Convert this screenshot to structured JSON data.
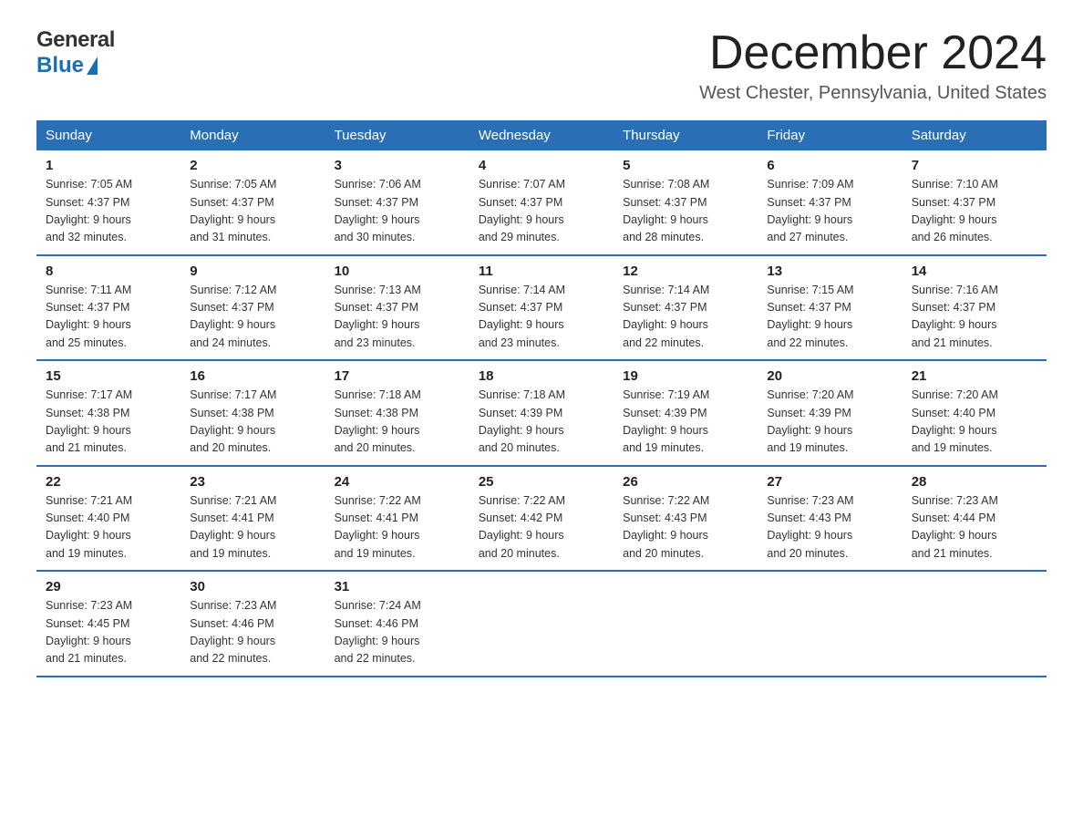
{
  "logo": {
    "general": "General",
    "blue": "Blue"
  },
  "title": "December 2024",
  "subtitle": "West Chester, Pennsylvania, United States",
  "days_of_week": [
    "Sunday",
    "Monday",
    "Tuesday",
    "Wednesday",
    "Thursday",
    "Friday",
    "Saturday"
  ],
  "weeks": [
    [
      {
        "day": "1",
        "sunrise": "7:05 AM",
        "sunset": "4:37 PM",
        "daylight": "9 hours and 32 minutes."
      },
      {
        "day": "2",
        "sunrise": "7:05 AM",
        "sunset": "4:37 PM",
        "daylight": "9 hours and 31 minutes."
      },
      {
        "day": "3",
        "sunrise": "7:06 AM",
        "sunset": "4:37 PM",
        "daylight": "9 hours and 30 minutes."
      },
      {
        "day": "4",
        "sunrise": "7:07 AM",
        "sunset": "4:37 PM",
        "daylight": "9 hours and 29 minutes."
      },
      {
        "day": "5",
        "sunrise": "7:08 AM",
        "sunset": "4:37 PM",
        "daylight": "9 hours and 28 minutes."
      },
      {
        "day": "6",
        "sunrise": "7:09 AM",
        "sunset": "4:37 PM",
        "daylight": "9 hours and 27 minutes."
      },
      {
        "day": "7",
        "sunrise": "7:10 AM",
        "sunset": "4:37 PM",
        "daylight": "9 hours and 26 minutes."
      }
    ],
    [
      {
        "day": "8",
        "sunrise": "7:11 AM",
        "sunset": "4:37 PM",
        "daylight": "9 hours and 25 minutes."
      },
      {
        "day": "9",
        "sunrise": "7:12 AM",
        "sunset": "4:37 PM",
        "daylight": "9 hours and 24 minutes."
      },
      {
        "day": "10",
        "sunrise": "7:13 AM",
        "sunset": "4:37 PM",
        "daylight": "9 hours and 23 minutes."
      },
      {
        "day": "11",
        "sunrise": "7:14 AM",
        "sunset": "4:37 PM",
        "daylight": "9 hours and 23 minutes."
      },
      {
        "day": "12",
        "sunrise": "7:14 AM",
        "sunset": "4:37 PM",
        "daylight": "9 hours and 22 minutes."
      },
      {
        "day": "13",
        "sunrise": "7:15 AM",
        "sunset": "4:37 PM",
        "daylight": "9 hours and 22 minutes."
      },
      {
        "day": "14",
        "sunrise": "7:16 AM",
        "sunset": "4:37 PM",
        "daylight": "9 hours and 21 minutes."
      }
    ],
    [
      {
        "day": "15",
        "sunrise": "7:17 AM",
        "sunset": "4:38 PM",
        "daylight": "9 hours and 21 minutes."
      },
      {
        "day": "16",
        "sunrise": "7:17 AM",
        "sunset": "4:38 PM",
        "daylight": "9 hours and 20 minutes."
      },
      {
        "day": "17",
        "sunrise": "7:18 AM",
        "sunset": "4:38 PM",
        "daylight": "9 hours and 20 minutes."
      },
      {
        "day": "18",
        "sunrise": "7:18 AM",
        "sunset": "4:39 PM",
        "daylight": "9 hours and 20 minutes."
      },
      {
        "day": "19",
        "sunrise": "7:19 AM",
        "sunset": "4:39 PM",
        "daylight": "9 hours and 19 minutes."
      },
      {
        "day": "20",
        "sunrise": "7:20 AM",
        "sunset": "4:39 PM",
        "daylight": "9 hours and 19 minutes."
      },
      {
        "day": "21",
        "sunrise": "7:20 AM",
        "sunset": "4:40 PM",
        "daylight": "9 hours and 19 minutes."
      }
    ],
    [
      {
        "day": "22",
        "sunrise": "7:21 AM",
        "sunset": "4:40 PM",
        "daylight": "9 hours and 19 minutes."
      },
      {
        "day": "23",
        "sunrise": "7:21 AM",
        "sunset": "4:41 PM",
        "daylight": "9 hours and 19 minutes."
      },
      {
        "day": "24",
        "sunrise": "7:22 AM",
        "sunset": "4:41 PM",
        "daylight": "9 hours and 19 minutes."
      },
      {
        "day": "25",
        "sunrise": "7:22 AM",
        "sunset": "4:42 PM",
        "daylight": "9 hours and 20 minutes."
      },
      {
        "day": "26",
        "sunrise": "7:22 AM",
        "sunset": "4:43 PM",
        "daylight": "9 hours and 20 minutes."
      },
      {
        "day": "27",
        "sunrise": "7:23 AM",
        "sunset": "4:43 PM",
        "daylight": "9 hours and 20 minutes."
      },
      {
        "day": "28",
        "sunrise": "7:23 AM",
        "sunset": "4:44 PM",
        "daylight": "9 hours and 21 minutes."
      }
    ],
    [
      {
        "day": "29",
        "sunrise": "7:23 AM",
        "sunset": "4:45 PM",
        "daylight": "9 hours and 21 minutes."
      },
      {
        "day": "30",
        "sunrise": "7:23 AM",
        "sunset": "4:46 PM",
        "daylight": "9 hours and 22 minutes."
      },
      {
        "day": "31",
        "sunrise": "7:24 AM",
        "sunset": "4:46 PM",
        "daylight": "9 hours and 22 minutes."
      },
      null,
      null,
      null,
      null
    ]
  ],
  "labels": {
    "sunrise": "Sunrise:",
    "sunset": "Sunset:",
    "daylight": "Daylight:"
  }
}
